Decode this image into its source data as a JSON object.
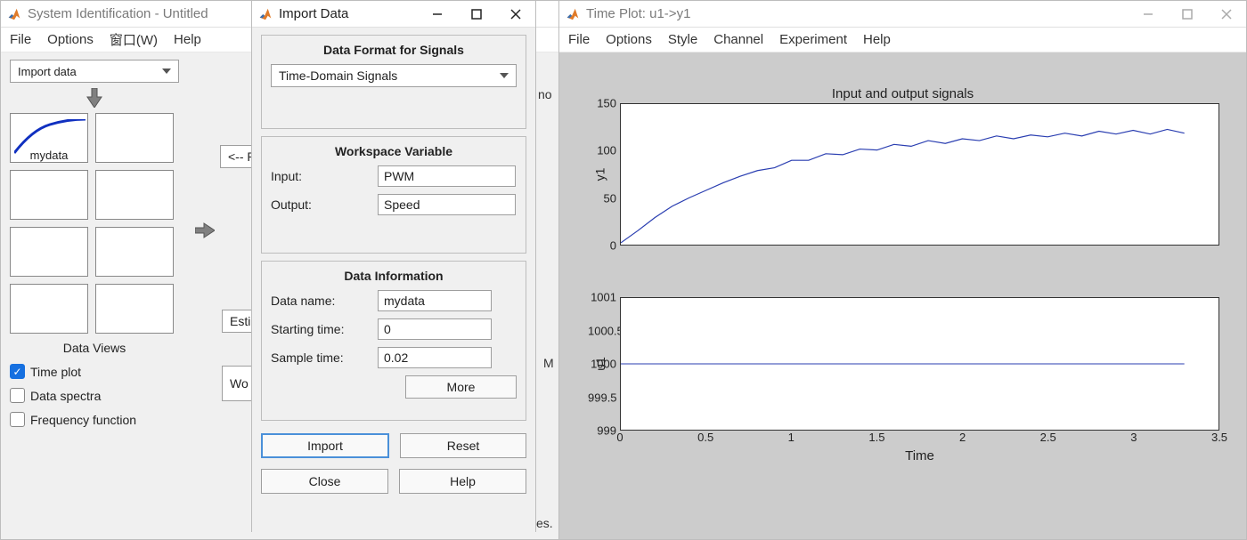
{
  "sysid_window": {
    "title": "System Identification - Untitled",
    "menu": [
      "File",
      "Options",
      "窗口(W)",
      "Help"
    ],
    "import_dropdown": "Import data",
    "data_slot_label": "mydata",
    "views_label": "Data Views",
    "checks": {
      "timeplot": "Time plot",
      "spectra": "Data spectra",
      "freq": "Frequency function"
    },
    "partial_btn1": "<-- P",
    "partial_btn2": "Esti",
    "partial_btn3": "Wo",
    "partial_text1": "no",
    "partial_text2": "M",
    "partial_text3": "es."
  },
  "import_dialog": {
    "title": "Import Data",
    "section1_title": "Data Format for Signals",
    "format_select": "Time-Domain Signals",
    "section2_title": "Workspace Variable",
    "input_label": "Input:",
    "input_value": "PWM",
    "output_label": "Output:",
    "output_value": "Speed",
    "section3_title": "Data Information",
    "dataname_label": "Data name:",
    "dataname_value": "mydata",
    "start_label": "Starting time:",
    "start_value": "0",
    "sample_label": "Sample time:",
    "sample_value": "0.02",
    "more_btn": "More",
    "import_btn": "Import",
    "reset_btn": "Reset",
    "close_btn": "Close",
    "help_btn": "Help"
  },
  "plot_window": {
    "title": "Time Plot: u1->y1",
    "menu": [
      "File",
      "Options",
      "Style",
      "Channel",
      "Experiment",
      "Help"
    ],
    "chart_title": "Input and output signals",
    "xlabel": "Time",
    "top_ylabel": "y1",
    "bot_ylabel": "u1",
    "top_yticks": [
      "0",
      "50",
      "100",
      "150"
    ],
    "bot_yticks": [
      "999",
      "999.5",
      "1000",
      "1000.5",
      "1001"
    ],
    "xticks": [
      "0",
      "0.5",
      "1",
      "1.5",
      "2",
      "2.5",
      "3",
      "3.5"
    ]
  },
  "chart_data": [
    {
      "type": "line",
      "title": "Input and output signals",
      "ylabel": "y1",
      "xlabel": "Time",
      "xlim": [
        0,
        3.5
      ],
      "ylim": [
        0,
        150
      ],
      "x": [
        0,
        0.1,
        0.2,
        0.3,
        0.4,
        0.5,
        0.6,
        0.7,
        0.8,
        0.9,
        1.0,
        1.1,
        1.2,
        1.3,
        1.4,
        1.5,
        1.6,
        1.7,
        1.8,
        1.9,
        2.0,
        2.1,
        2.2,
        2.3,
        2.4,
        2.5,
        2.6,
        2.7,
        2.8,
        2.9,
        3.0,
        3.1,
        3.2,
        3.3
      ],
      "values": [
        2,
        15,
        29,
        41,
        50,
        58,
        66,
        73,
        79,
        84,
        88,
        92,
        95,
        98,
        100,
        103,
        105,
        107,
        109,
        110,
        111,
        113,
        114,
        115,
        115,
        117,
        117,
        118,
        119,
        120,
        120,
        120,
        121,
        121
      ],
      "series_name": "y1"
    },
    {
      "type": "line",
      "title": "",
      "ylabel": "u1",
      "xlabel": "Time",
      "xlim": [
        0,
        3.5
      ],
      "ylim": [
        999,
        1001
      ],
      "x": [
        0,
        3.3
      ],
      "values": [
        1000,
        1000
      ],
      "series_name": "u1"
    }
  ]
}
